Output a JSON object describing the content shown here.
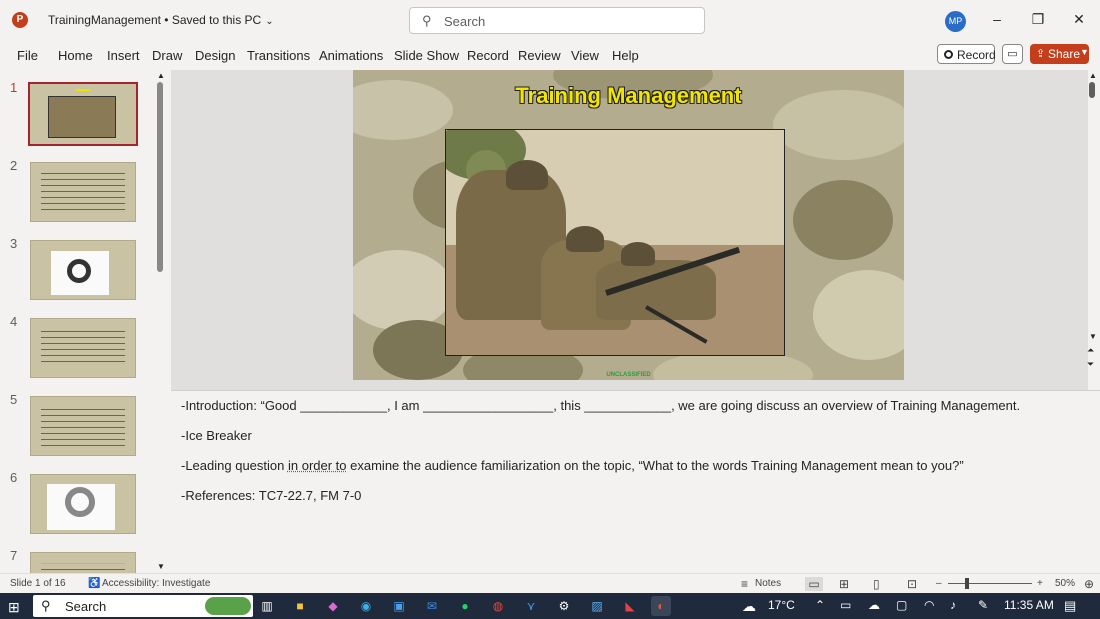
{
  "window": {
    "app_logo": "P",
    "title": "TrainingManagement • Saved to this PC",
    "search_placeholder": "Search",
    "avatar_initials": "MP"
  },
  "ribbon": {
    "tabs": [
      "File",
      "Home",
      "Insert",
      "Draw",
      "Design",
      "Transitions",
      "Animations",
      "Slide Show",
      "Record",
      "Review",
      "View",
      "Help"
    ],
    "record_label": "Record",
    "share_label": "Share"
  },
  "thumbnails": {
    "numbers": [
      "1",
      "2",
      "3",
      "4",
      "5",
      "6",
      "7"
    ],
    "selected": 1
  },
  "slide": {
    "title": "Training Management",
    "footer": "UNCLASSIFIED"
  },
  "notes": {
    "line1": "-Introduction: “Good ____________, I am __________________, this ____________, we are going discuss an overview of Training Management.",
    "line2": "-Ice Breaker",
    "line3_pre": "-Leading question ",
    "line3_ul": "in order to",
    "line3_post": " examine the audience familiarization on the topic, “What to the words Training Management mean to you?”",
    "line4": "-References: TC7-22.7, FM 7-0"
  },
  "status": {
    "slide_count": "Slide 1 of 16",
    "accessibility": "Accessibility: Investigate",
    "notes_label": "Notes",
    "zoom": "50%"
  },
  "taskbar": {
    "search_placeholder": "Search",
    "temperature": "17°C",
    "time": "11:35 AM"
  },
  "colors": {
    "accent": "#c43e1c",
    "title_yellow": "#f2e600",
    "taskbar": "#1f2a3c"
  }
}
